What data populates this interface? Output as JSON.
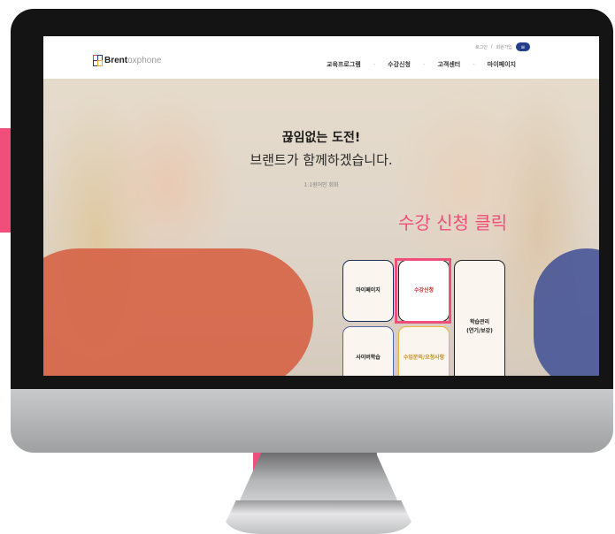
{
  "brand": {
    "logo_bold": "Brent",
    "logo_light": "oxphone"
  },
  "utility": {
    "login": "로그인",
    "divider": "/",
    "signup": "회원가입",
    "menu_glyph": "≡"
  },
  "nav": {
    "items": [
      "교육프로그램",
      "수강신청",
      "고객센터",
      "마이페이지"
    ]
  },
  "hero": {
    "headline": "끊임없는 도전!",
    "subline": "브랜트가 함께하겠습니다.",
    "tagline": "1:1원어민 회화"
  },
  "callout": "수강 신청 클릭",
  "quick_menu": {
    "mypage": "마이페이지",
    "apply": "수강신청",
    "study_line1": "학습관리",
    "study_line2": "(연기/보강)",
    "cyber": "사이버학습",
    "inquiry": "수업문의/요청사항"
  },
  "colors": {
    "accent_pink": "#ef4f7a",
    "brand_navy": "#243e8c",
    "coral": "#d66042"
  },
  "icons": [
    "menu-icon",
    "logo-icon"
  ]
}
